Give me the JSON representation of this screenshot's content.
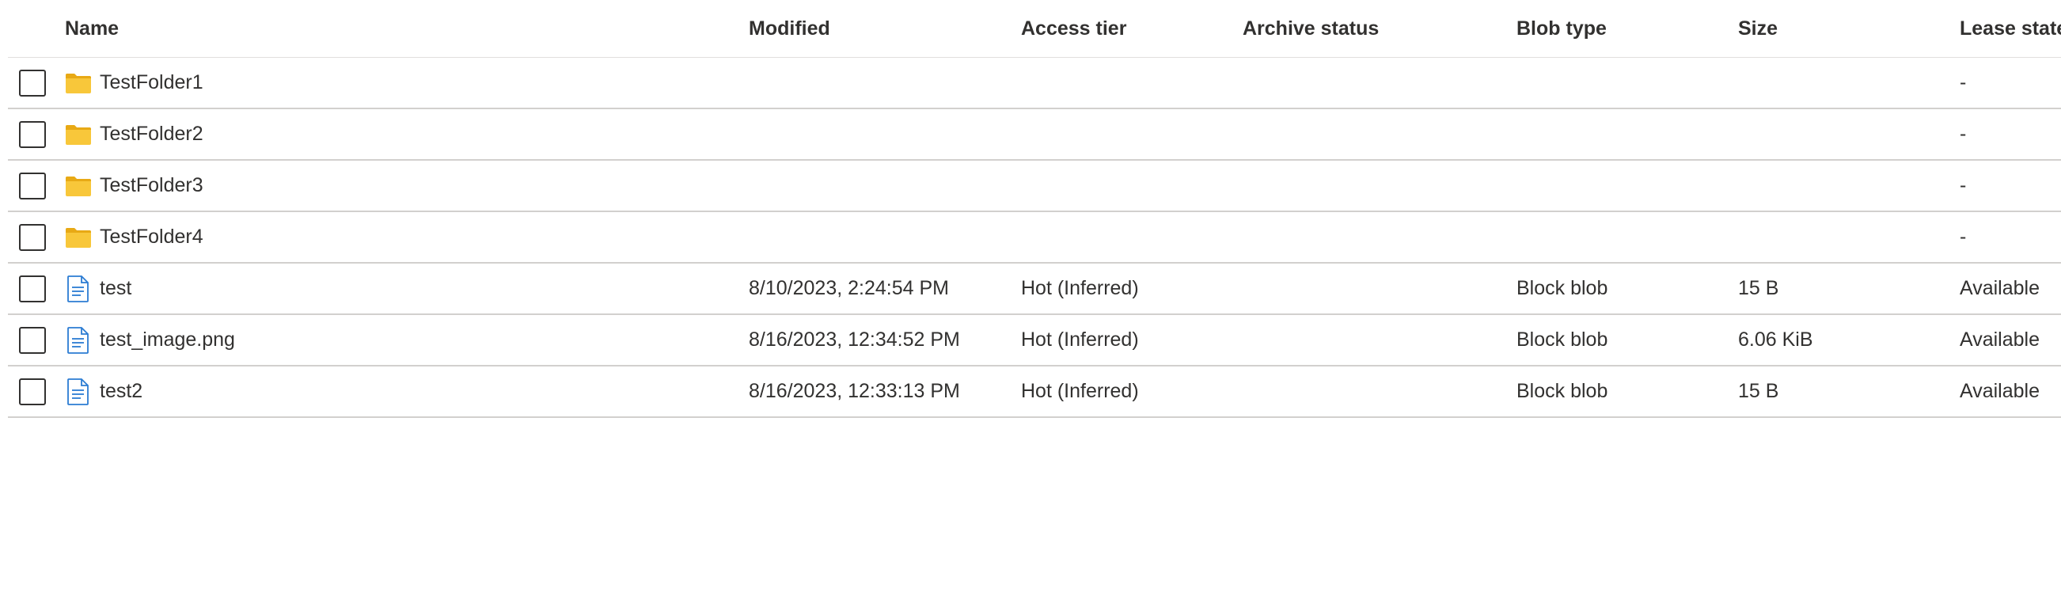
{
  "columns": {
    "name": "Name",
    "modified": "Modified",
    "access_tier": "Access tier",
    "archive_status": "Archive status",
    "blob_type": "Blob type",
    "size": "Size",
    "lease_state": "Lease state"
  },
  "rows": [
    {
      "type": "folder",
      "icon": "folder-icon",
      "name": "TestFolder1",
      "modified": "",
      "access_tier": "",
      "archive_status": "",
      "blob_type": "",
      "size": "",
      "lease_state": "-"
    },
    {
      "type": "folder",
      "icon": "folder-icon",
      "name": "TestFolder2",
      "modified": "",
      "access_tier": "",
      "archive_status": "",
      "blob_type": "",
      "size": "",
      "lease_state": "-"
    },
    {
      "type": "folder",
      "icon": "folder-icon",
      "name": "TestFolder3",
      "modified": "",
      "access_tier": "",
      "archive_status": "",
      "blob_type": "",
      "size": "",
      "lease_state": "-"
    },
    {
      "type": "folder",
      "icon": "folder-icon",
      "name": "TestFolder4",
      "modified": "",
      "access_tier": "",
      "archive_status": "",
      "blob_type": "",
      "size": "",
      "lease_state": "-"
    },
    {
      "type": "file",
      "icon": "document-icon",
      "name": "test",
      "modified": "8/10/2023, 2:24:54 PM",
      "access_tier": "Hot (Inferred)",
      "archive_status": "",
      "blob_type": "Block blob",
      "size": "15 B",
      "lease_state": "Available"
    },
    {
      "type": "file",
      "icon": "document-icon",
      "name": "test_image.png",
      "modified": "8/16/2023, 12:34:52 PM",
      "access_tier": "Hot (Inferred)",
      "archive_status": "",
      "blob_type": "Block blob",
      "size": "6.06 KiB",
      "lease_state": "Available"
    },
    {
      "type": "file",
      "icon": "document-icon",
      "name": "test2",
      "modified": "8/16/2023, 12:33:13 PM",
      "access_tier": "Hot (Inferred)",
      "archive_status": "",
      "blob_type": "Block blob",
      "size": "15 B",
      "lease_state": "Available"
    }
  ],
  "colors": {
    "folder": "#f8c73a",
    "folder_tab": "#e8a915",
    "document": "#2b7cd3",
    "row_border": "#d2d0ce",
    "text": "#323130"
  }
}
